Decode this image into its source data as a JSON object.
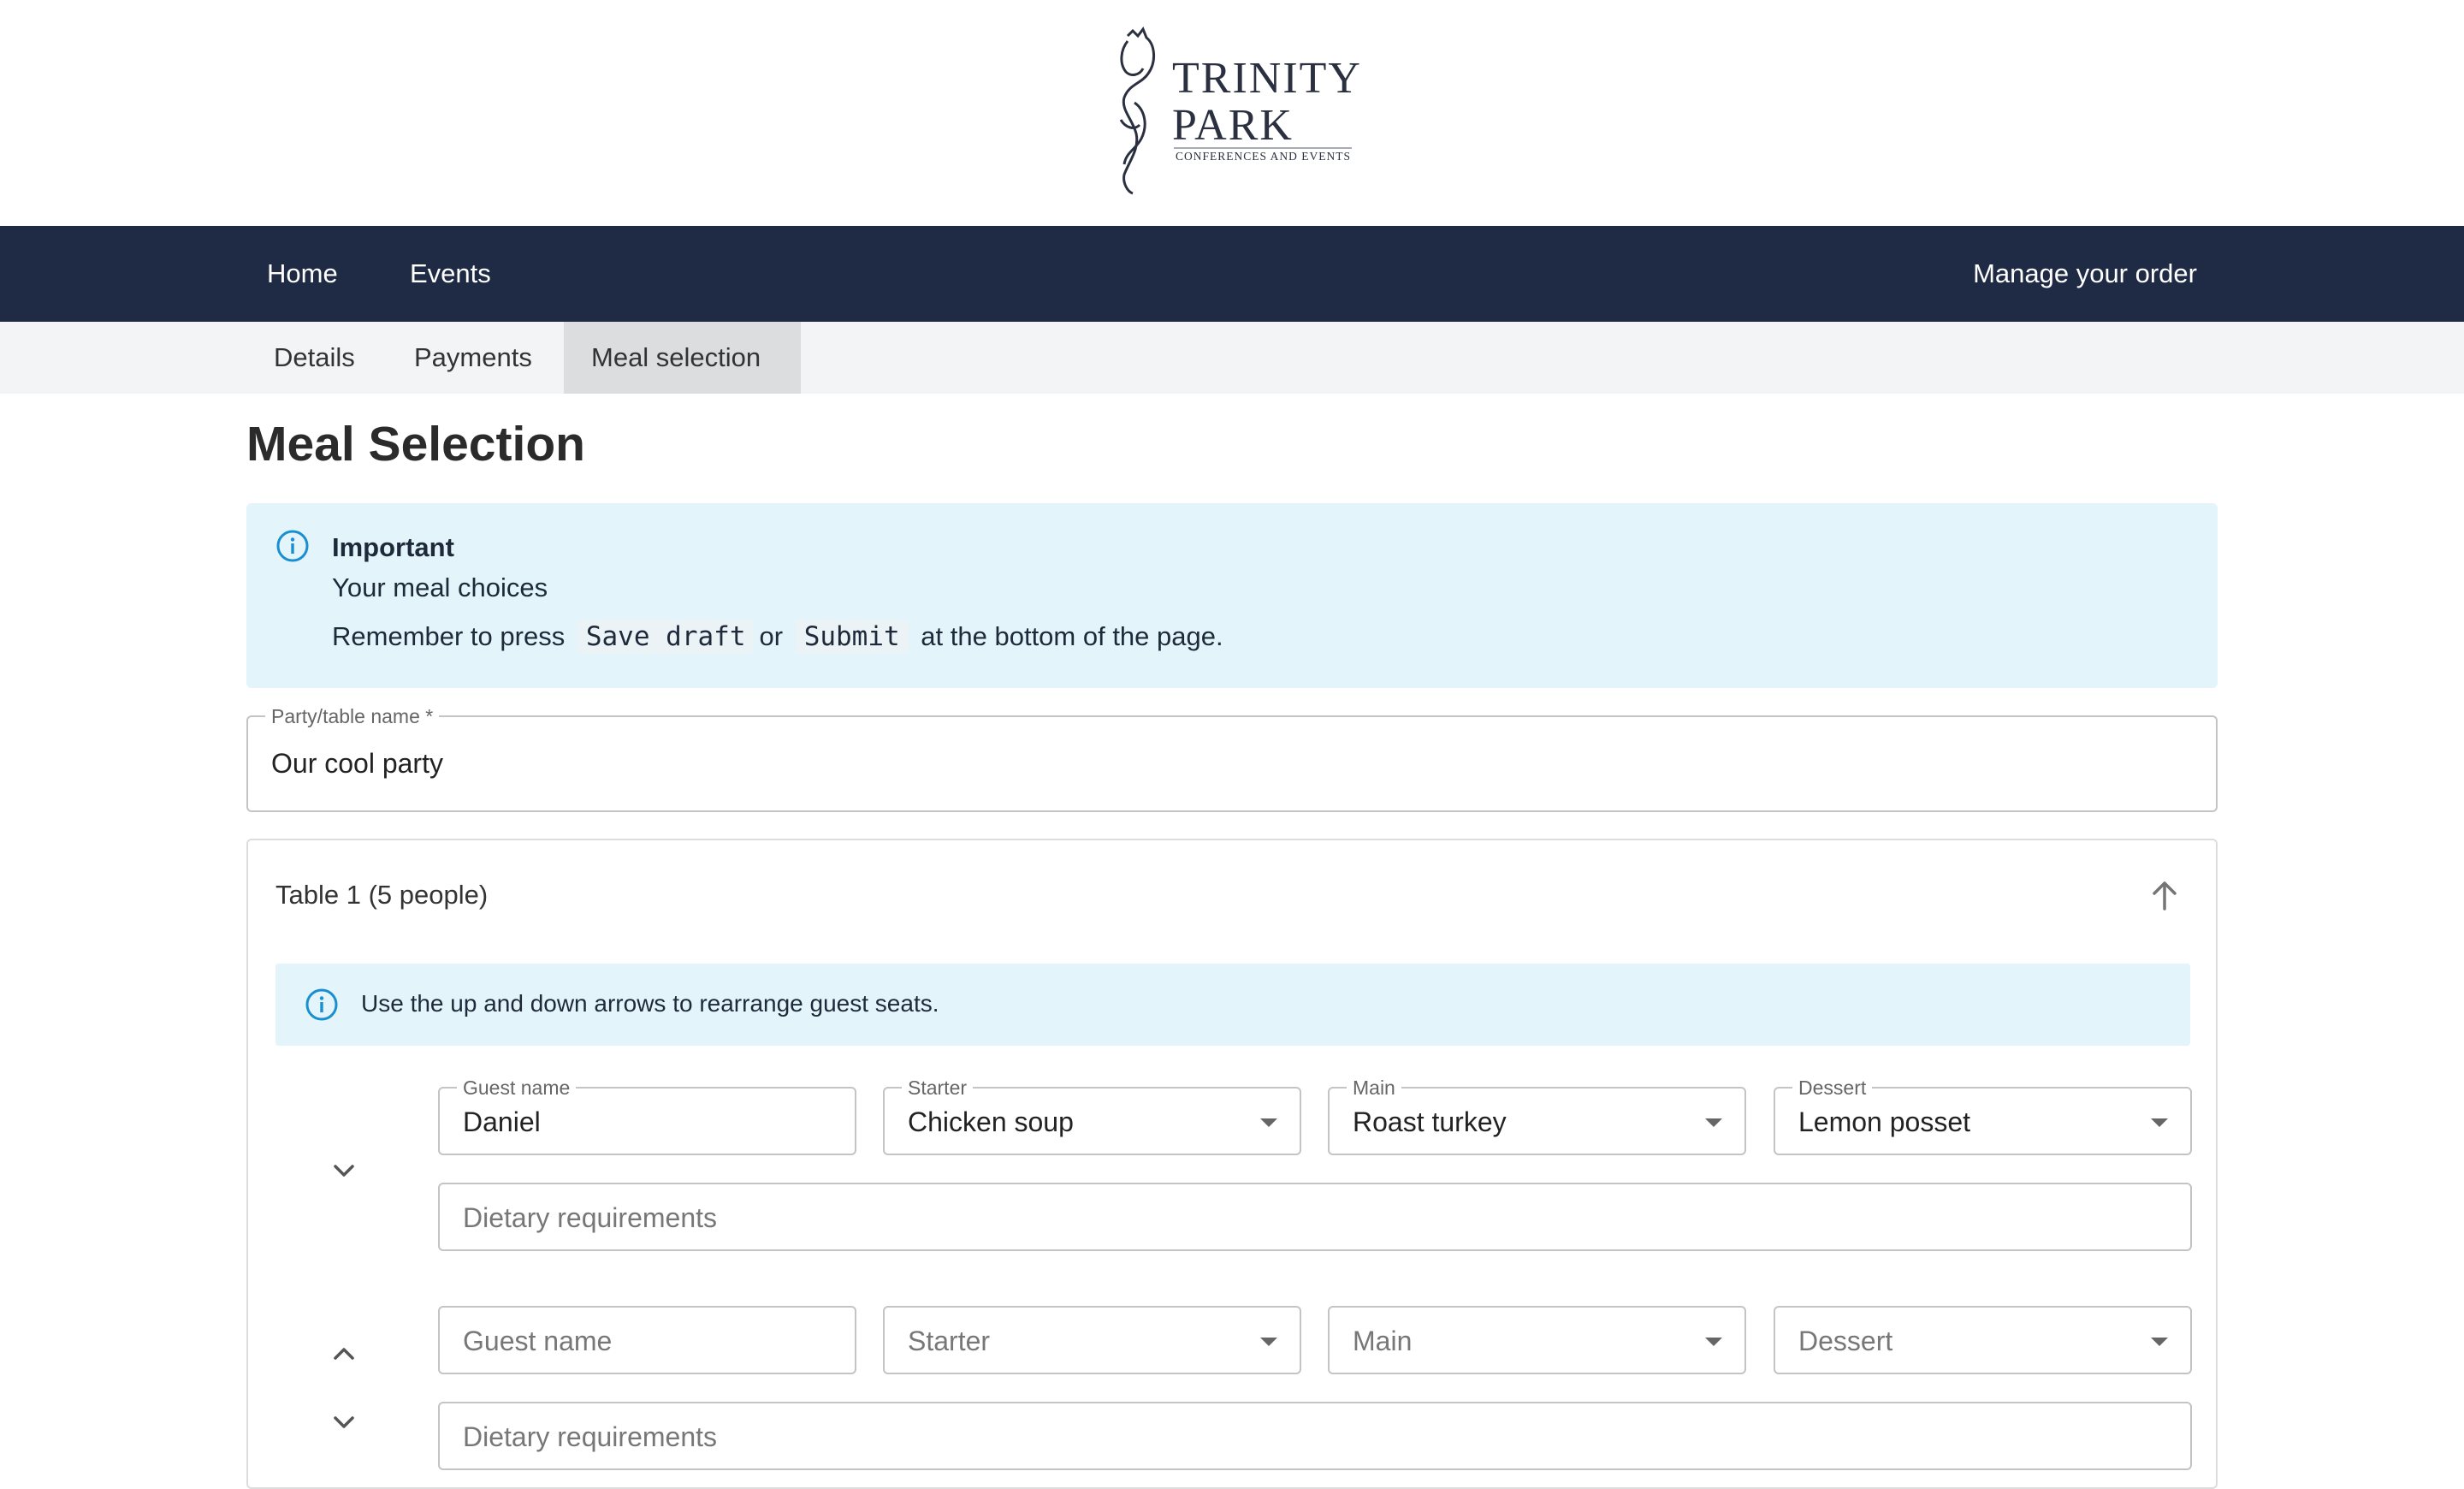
{
  "brand": {
    "line1": "TRINITY",
    "line2": "PARK",
    "tagline": "CONFERENCES AND EVENTS"
  },
  "nav": {
    "home": "Home",
    "events": "Events",
    "manage": "Manage your order"
  },
  "tabs": {
    "details": "Details",
    "payments": "Payments",
    "meal": "Meal selection"
  },
  "page": {
    "title": "Meal Selection"
  },
  "important": {
    "title": "Important",
    "subtitle": "Your meal choices",
    "line_prefix": "Remember to press",
    "save_draft": "Save draft",
    "or": "or",
    "submit": "Submit",
    "line_suffix": "at the bottom of the page."
  },
  "party": {
    "label": "Party/table name *",
    "value": "Our cool party"
  },
  "table": {
    "title": "Table 1 (5 people)",
    "info": "Use the up and down arrows to rearrange guest seats.",
    "guests": [
      {
        "name_label": "Guest name",
        "name": "Daniel",
        "starter_label": "Starter",
        "starter": "Chicken soup",
        "main_label": "Main",
        "main": "Roast turkey",
        "dessert_label": "Dessert",
        "dessert": "Lemon posset",
        "dietary_placeholder": "Dietary requirements"
      },
      {
        "name_placeholder": "Guest name",
        "starter_placeholder": "Starter",
        "main_placeholder": "Main",
        "dessert_placeholder": "Dessert",
        "dietary_placeholder": "Dietary requirements"
      }
    ]
  },
  "colors": {
    "nav_bg": "#1f2a45",
    "info_bg": "#e3f4fb",
    "info_icon": "#1a8fcf",
    "active_tab_bg": "#dcdddf"
  }
}
